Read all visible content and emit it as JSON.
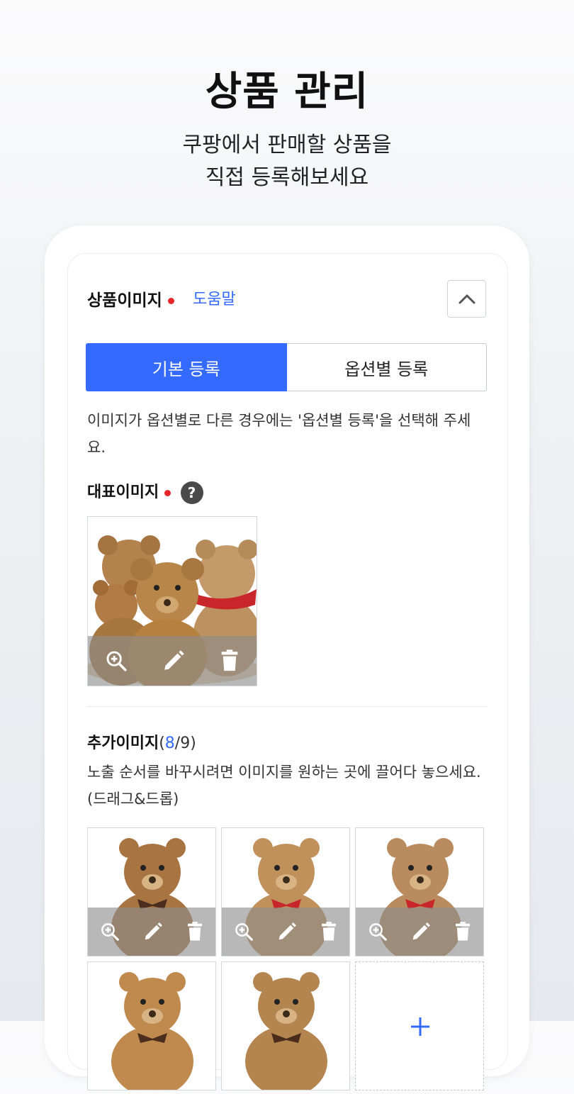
{
  "hero": {
    "title": "상품 관리",
    "subtitle_line1": "쿠팡에서 판매할 상품을",
    "subtitle_line2": "직접 등록해보세요"
  },
  "section": {
    "title": "상품이미지",
    "help_label": "도움말",
    "collapse_icon": "chevron-up-icon"
  },
  "tabs": [
    {
      "label": "기본 등록",
      "active": true
    },
    {
      "label": "옵션별 등록",
      "active": false
    }
  ],
  "notice": "이미지가 옵션별로 다른 경우에는 '옵션별 등록'을 선택해 주세요.",
  "main_image": {
    "title": "대표이미지",
    "help_icon": "?"
  },
  "additional_images": {
    "title": "추가이미지",
    "count_open": "(",
    "count_current": "8",
    "count_sep_total": "/9)",
    "instruction": "노출 순서를 바꾸시려면 이미지를 원하는 곳에 끌어다 놓으세요. (드래그&드롭)"
  },
  "colors": {
    "accent": "#346aff",
    "required": "#e52528"
  },
  "thumb_actions": [
    "zoom-in-icon",
    "edit-pencil-icon",
    "trash-icon"
  ]
}
